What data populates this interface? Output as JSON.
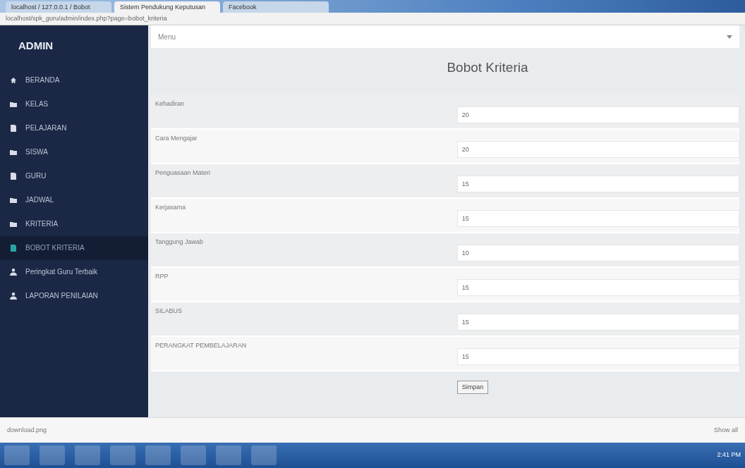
{
  "browser": {
    "tabs": [
      {
        "title": "localhost / 127.0.0.1 / Bobot",
        "selected": false
      },
      {
        "title": "Sistem Pendukung Keputusan",
        "selected": true
      },
      {
        "title": "Facebook",
        "selected": false
      }
    ],
    "url": "localhost/spk_guru/admin/index.php?page=bobot_kriteria"
  },
  "sidebar": {
    "title": "ADMIN",
    "items": [
      {
        "label": "BERANDA",
        "kind": "home",
        "selected": false
      },
      {
        "label": "KELAS",
        "kind": "folder",
        "selected": false
      },
      {
        "label": "PELAJARAN",
        "kind": "file",
        "selected": false
      },
      {
        "label": "SISWA",
        "kind": "folder",
        "selected": false
      },
      {
        "label": "GURU",
        "kind": "file",
        "selected": false
      },
      {
        "label": "JADWAL",
        "kind": "folder",
        "selected": false
      },
      {
        "label": "KRITERIA",
        "kind": "folder",
        "selected": false
      },
      {
        "label": "BOBOT KRITERIA",
        "kind": "file",
        "selected": true
      },
      {
        "label": "Peringkat Guru Terbaik",
        "kind": "user",
        "selected": false
      },
      {
        "label": "LAPORAN PENILAIAN",
        "kind": "user",
        "selected": false
      }
    ]
  },
  "topbar": {
    "menu_label": "Menu"
  },
  "page": {
    "title": "Bobot Kriteria",
    "fields": [
      {
        "label": "Kehadiran",
        "value": "20"
      },
      {
        "label": "Cara Mengajar",
        "value": "20"
      },
      {
        "label": "Penguasaan Materi",
        "value": "15"
      },
      {
        "label": "Kerjasama",
        "value": "15"
      },
      {
        "label": "Tanggung Jawab",
        "value": "10"
      },
      {
        "label": "RPP",
        "value": "15"
      },
      {
        "label": "SILABUS",
        "value": "15"
      },
      {
        "label": "PERANGKAT PEMBELAJARAN",
        "value": "15"
      }
    ],
    "submit": "Simpan"
  },
  "download_bar": {
    "file": "download.png",
    "show_all": "Show all"
  },
  "taskbar": {
    "time": "2:41 PM"
  }
}
